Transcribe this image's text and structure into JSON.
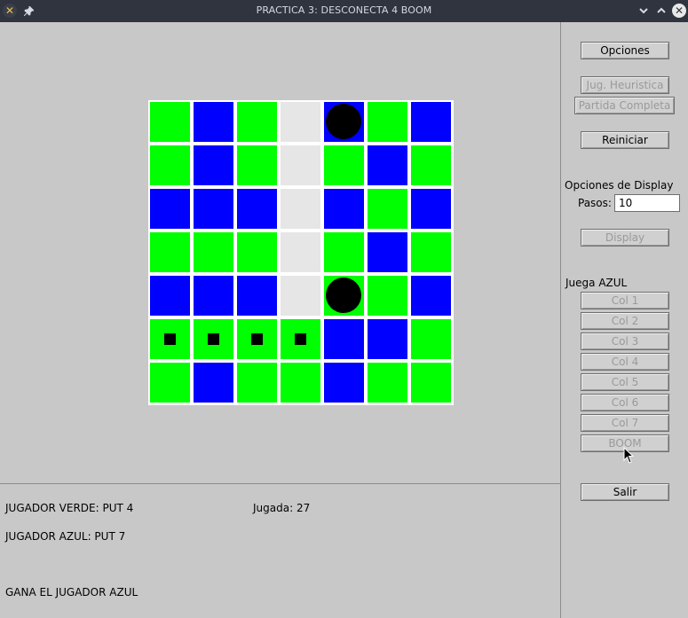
{
  "window": {
    "title": "PRACTICA 3: DESCONECTA 4 BOOM",
    "app_icon": "x-app-icon",
    "pin_icon": "pin-icon"
  },
  "colors": {
    "green": "#00ff00",
    "blue": "#0000ff",
    "empty": "#e6e6e6",
    "piece": "#000000"
  },
  "board": {
    "rows": [
      [
        "green",
        "blue",
        "green",
        "empty",
        "blue",
        "green",
        "blue"
      ],
      [
        "green",
        "blue",
        "green",
        "empty",
        "green",
        "blue",
        "green"
      ],
      [
        "blue",
        "blue",
        "blue",
        "empty",
        "blue",
        "green",
        "blue"
      ],
      [
        "green",
        "green",
        "green",
        "empty",
        "green",
        "blue",
        "green"
      ],
      [
        "blue",
        "blue",
        "blue",
        "empty",
        "green",
        "green",
        "blue"
      ],
      [
        "green",
        "green",
        "green",
        "green",
        "blue",
        "blue",
        "green"
      ],
      [
        "green",
        "blue",
        "green",
        "green",
        "blue",
        "green",
        "green"
      ]
    ],
    "pieces": [
      [
        0,
        4
      ],
      [
        4,
        4
      ]
    ],
    "marks": [
      [
        5,
        0
      ],
      [
        5,
        1
      ],
      [
        5,
        2
      ],
      [
        5,
        3
      ]
    ]
  },
  "panel": {
    "opciones": "Opciones",
    "jug_heuristica": "Jug. Heuristica",
    "partida_completa": "Partida Completa",
    "reiniciar": "Reiniciar",
    "display_options_label": "Opciones de Display",
    "pasos_label": "Pasos:",
    "pasos_value": "10",
    "display": "Display",
    "turn_label": "Juega AZUL",
    "columns": [
      "Col 1",
      "Col 2",
      "Col 3",
      "Col 4",
      "Col 5",
      "Col 6",
      "Col 7"
    ],
    "boom": "BOOM",
    "salir": "Salir"
  },
  "status": {
    "verde": "JUGADOR VERDE: PUT 4",
    "jugada": "Jugada: 27",
    "azul": "JUGADOR AZUL: PUT 7",
    "result": "GANA EL JUGADOR AZUL"
  }
}
